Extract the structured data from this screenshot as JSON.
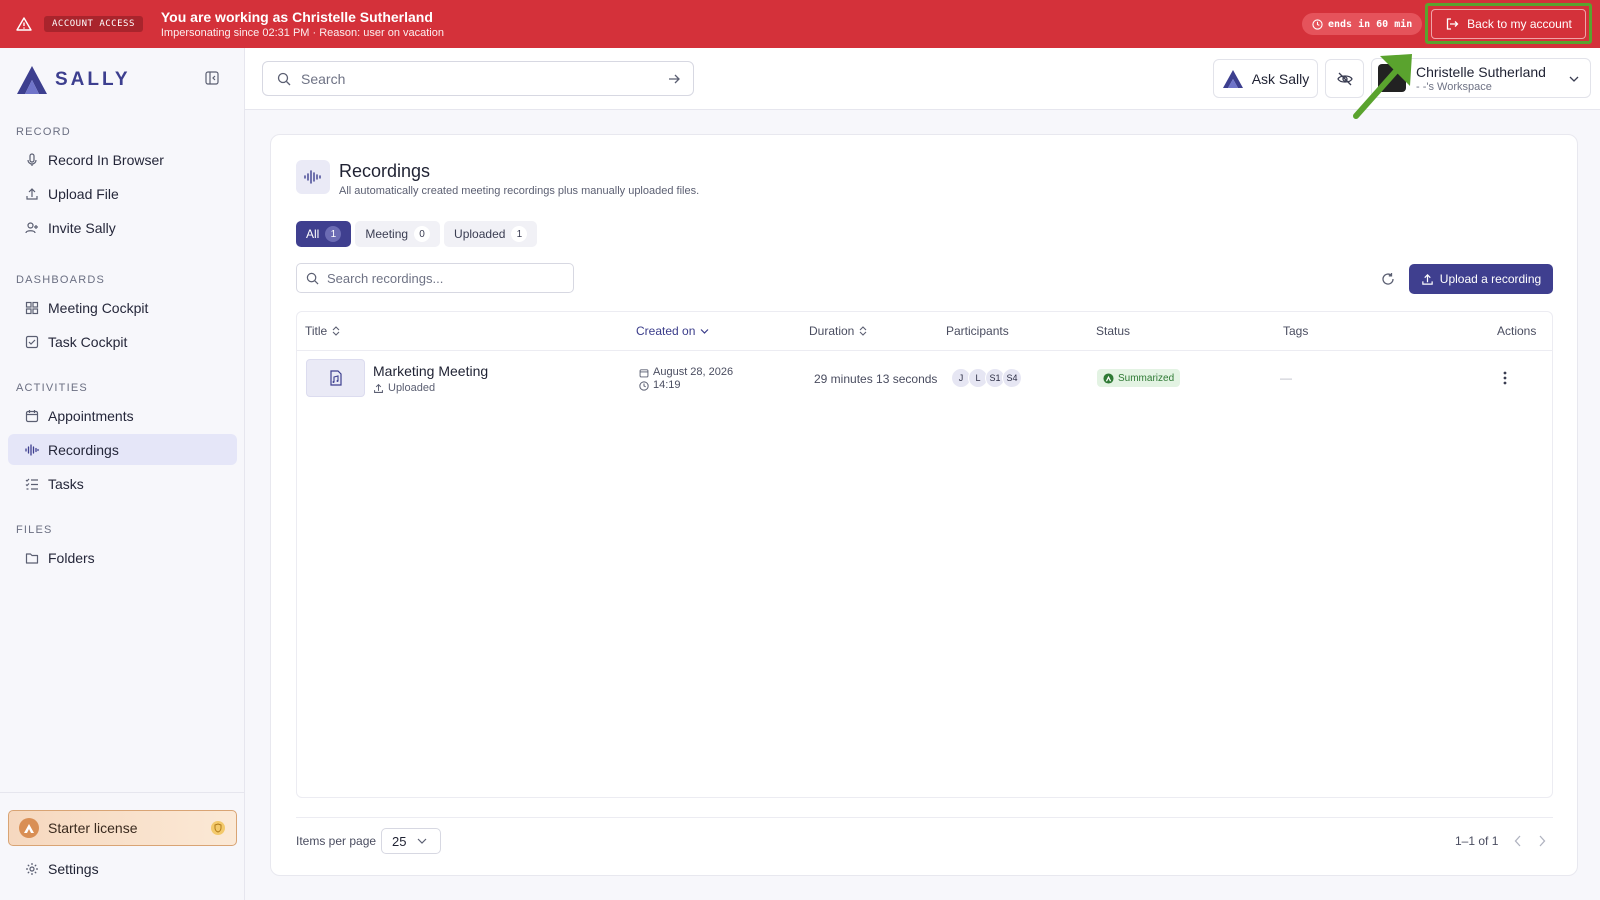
{
  "banner": {
    "badge": "ACCOUNT ACCESS",
    "title": "You are working as Christelle Sutherland",
    "subtitle": "Impersonating since 02:31 PM · Reason: user on vacation",
    "timer": "ends in 60 min",
    "back_label": "Back to my account"
  },
  "brand": {
    "name": "SALLY",
    "color": "#3d3f8f"
  },
  "sidebar": {
    "sections": [
      {
        "label": "RECORD"
      },
      {
        "label": "DASHBOARDS"
      },
      {
        "label": "ACTIVITIES"
      },
      {
        "label": "FILES"
      }
    ],
    "items": [
      {
        "label": "Record In Browser",
        "icon": "mic-icon"
      },
      {
        "label": "Upload File",
        "icon": "upload-icon"
      },
      {
        "label": "Invite Sally",
        "icon": "user-plus-icon"
      },
      {
        "label": "Meeting Cockpit",
        "icon": "grid-icon"
      },
      {
        "label": "Task Cockpit",
        "icon": "checkbox-icon"
      },
      {
        "label": "Appointments",
        "icon": "calendar-icon"
      },
      {
        "label": "Recordings",
        "icon": "waveform-icon",
        "active": true
      },
      {
        "label": "Tasks",
        "icon": "list-check-icon"
      },
      {
        "label": "Folders",
        "icon": "folder-icon"
      }
    ],
    "license": "Starter license",
    "settings": "Settings"
  },
  "topbar": {
    "search_placeholder": "Search",
    "ask_label": "Ask Sally",
    "user_name": "Christelle Sutherland",
    "workspace": "- -'s Workspace"
  },
  "recordings": {
    "title": "Recordings",
    "subtitle": "All automatically created meeting recordings plus manually uploaded files.",
    "tabs": [
      {
        "label": "All",
        "count": "1",
        "active": true
      },
      {
        "label": "Meeting",
        "count": "0"
      },
      {
        "label": "Uploaded",
        "count": "1"
      }
    ],
    "search_placeholder": "Search recordings...",
    "upload_label": "Upload a recording",
    "columns": [
      "Title",
      "Created on",
      "Duration",
      "Participants",
      "Status",
      "Tags",
      "Actions"
    ],
    "rows": [
      {
        "title": "Marketing Meeting",
        "source": "Uploaded",
        "date": "August 28, 2026",
        "time": "14:19",
        "duration": "29 minutes 13 seconds",
        "participants": [
          "J",
          "L",
          "S1",
          "S4"
        ],
        "status": "Summarized",
        "tags": "—"
      }
    ],
    "items_per_page_label": "Items per page",
    "items_per_page": "25",
    "range": "1–1 of 1"
  },
  "colors": {
    "banner": "#d4313a",
    "accent": "#3f3f8f",
    "highlight": "#5aa32e"
  }
}
